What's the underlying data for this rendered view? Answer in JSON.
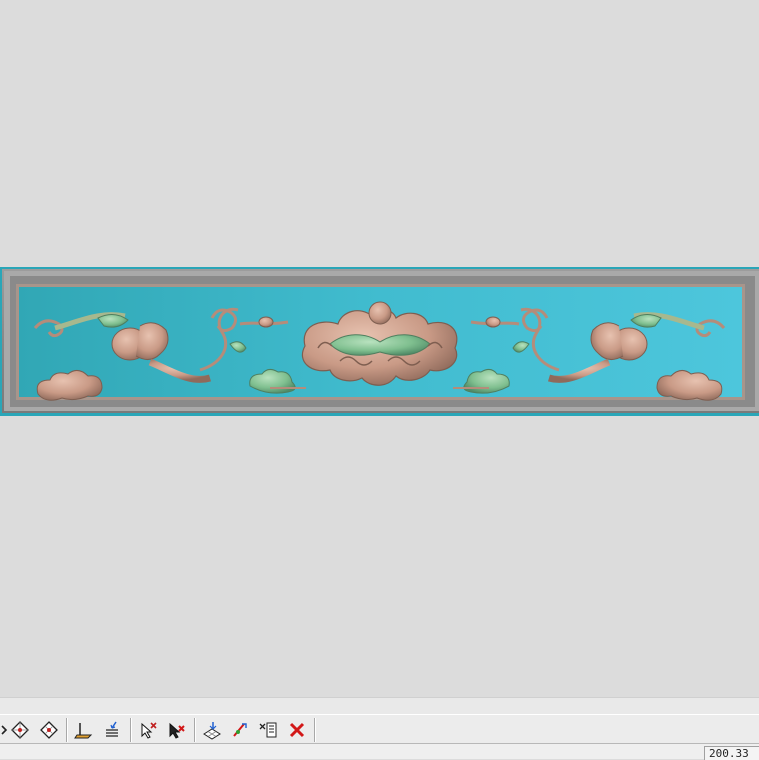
{
  "toolbar": {
    "buttons": [
      {
        "icon": "arrow-partial-icon"
      },
      {
        "icon": "diamond-view-icon"
      },
      {
        "icon": "diamond-view-alt-icon"
      },
      {
        "icon": "layer-base-icon"
      },
      {
        "icon": "layer-stack-icon"
      },
      {
        "icon": "select-cross-icon"
      },
      {
        "icon": "delete-select-icon"
      },
      {
        "icon": "grid-project-icon"
      },
      {
        "icon": "pen-transform-icon"
      },
      {
        "icon": "list-select-icon"
      },
      {
        "icon": "close-red-icon"
      }
    ]
  },
  "status": {
    "coordinate": "200.33"
  },
  "colors": {
    "viewport_bg": "#dcdcdc",
    "panel_field": "#4cc0d4",
    "panel_frame": "#8c8c8c",
    "carving_rose": "#c99a86",
    "carving_green": "#7fbf8f",
    "delete_red": "#d21818"
  }
}
